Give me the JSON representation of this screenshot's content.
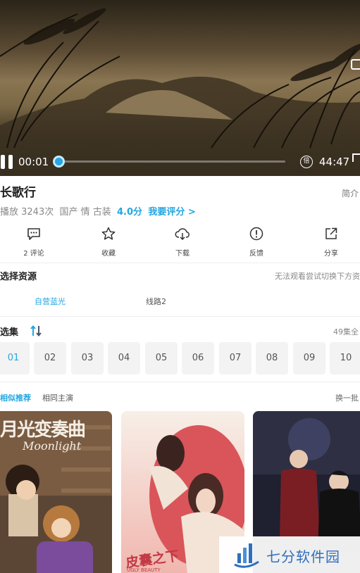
{
  "player": {
    "current_time": "00:01",
    "total_time": "44:47",
    "progress": 0.0,
    "speed_label": "倍"
  },
  "show": {
    "title": "长歌行",
    "intro_label": "简介",
    "plays": "播放 3243次",
    "tags": "国产 情 古装",
    "score": "4.0分",
    "rate_label": "我要评分 >"
  },
  "actions": [
    {
      "icon": "comment-icon",
      "label": "2 评论"
    },
    {
      "icon": "star-icon",
      "label": "收藏"
    },
    {
      "icon": "cloud-download-icon",
      "label": "下载"
    },
    {
      "icon": "alert-icon",
      "label": "反馈"
    },
    {
      "icon": "share-icon",
      "label": "分享"
    }
  ],
  "source": {
    "title": "选择资源",
    "hint": "无法观看尝试切换下方资",
    "options": [
      "自营蓝光",
      "线路2"
    ],
    "selected": "自营蓝光"
  },
  "episodes": {
    "title": "选集",
    "count": "49集全",
    "items": [
      "01",
      "02",
      "03",
      "04",
      "05",
      "06",
      "07",
      "08",
      "09",
      "10"
    ],
    "selected": "01"
  },
  "recommend": {
    "tabs": [
      "相似推荐",
      "相同主演"
    ],
    "refresh": "换一批",
    "posters": [
      {
        "title": "月光变奏曲",
        "subtitle": "Moonlight"
      },
      {
        "title": "皮囊之下",
        "subtitle": "UGLY BEAUTY"
      },
      {
        "title": ""
      }
    ]
  },
  "watermark": {
    "text": "七分软件园"
  },
  "colors": {
    "accent": "#23a6e0",
    "text": "#333333",
    "muted": "#888888"
  }
}
